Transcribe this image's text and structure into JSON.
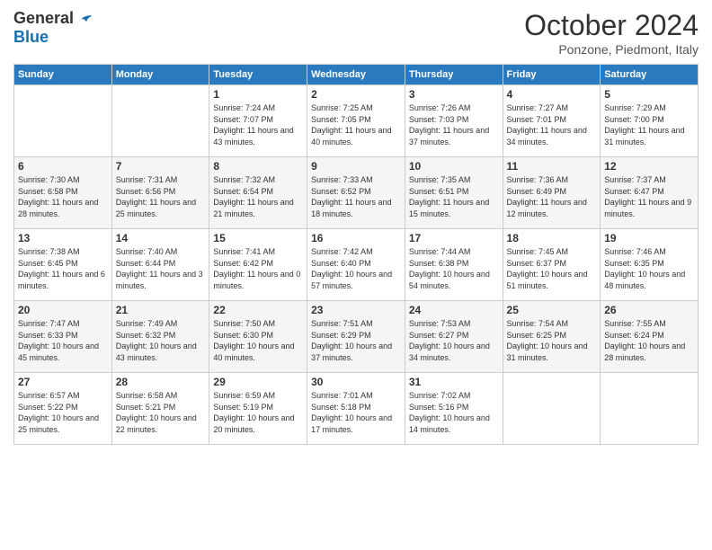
{
  "header": {
    "logo_general": "General",
    "logo_blue": "Blue",
    "month_title": "October 2024",
    "location": "Ponzone, Piedmont, Italy"
  },
  "days_of_week": [
    "Sunday",
    "Monday",
    "Tuesday",
    "Wednesday",
    "Thursday",
    "Friday",
    "Saturday"
  ],
  "weeks": [
    [
      {
        "day": "",
        "info": ""
      },
      {
        "day": "",
        "info": ""
      },
      {
        "day": "1",
        "info": "Sunrise: 7:24 AM\nSunset: 7:07 PM\nDaylight: 11 hours and 43 minutes."
      },
      {
        "day": "2",
        "info": "Sunrise: 7:25 AM\nSunset: 7:05 PM\nDaylight: 11 hours and 40 minutes."
      },
      {
        "day": "3",
        "info": "Sunrise: 7:26 AM\nSunset: 7:03 PM\nDaylight: 11 hours and 37 minutes."
      },
      {
        "day": "4",
        "info": "Sunrise: 7:27 AM\nSunset: 7:01 PM\nDaylight: 11 hours and 34 minutes."
      },
      {
        "day": "5",
        "info": "Sunrise: 7:29 AM\nSunset: 7:00 PM\nDaylight: 11 hours and 31 minutes."
      }
    ],
    [
      {
        "day": "6",
        "info": "Sunrise: 7:30 AM\nSunset: 6:58 PM\nDaylight: 11 hours and 28 minutes."
      },
      {
        "day": "7",
        "info": "Sunrise: 7:31 AM\nSunset: 6:56 PM\nDaylight: 11 hours and 25 minutes."
      },
      {
        "day": "8",
        "info": "Sunrise: 7:32 AM\nSunset: 6:54 PM\nDaylight: 11 hours and 21 minutes."
      },
      {
        "day": "9",
        "info": "Sunrise: 7:33 AM\nSunset: 6:52 PM\nDaylight: 11 hours and 18 minutes."
      },
      {
        "day": "10",
        "info": "Sunrise: 7:35 AM\nSunset: 6:51 PM\nDaylight: 11 hours and 15 minutes."
      },
      {
        "day": "11",
        "info": "Sunrise: 7:36 AM\nSunset: 6:49 PM\nDaylight: 11 hours and 12 minutes."
      },
      {
        "day": "12",
        "info": "Sunrise: 7:37 AM\nSunset: 6:47 PM\nDaylight: 11 hours and 9 minutes."
      }
    ],
    [
      {
        "day": "13",
        "info": "Sunrise: 7:38 AM\nSunset: 6:45 PM\nDaylight: 11 hours and 6 minutes."
      },
      {
        "day": "14",
        "info": "Sunrise: 7:40 AM\nSunset: 6:44 PM\nDaylight: 11 hours and 3 minutes."
      },
      {
        "day": "15",
        "info": "Sunrise: 7:41 AM\nSunset: 6:42 PM\nDaylight: 11 hours and 0 minutes."
      },
      {
        "day": "16",
        "info": "Sunrise: 7:42 AM\nSunset: 6:40 PM\nDaylight: 10 hours and 57 minutes."
      },
      {
        "day": "17",
        "info": "Sunrise: 7:44 AM\nSunset: 6:38 PM\nDaylight: 10 hours and 54 minutes."
      },
      {
        "day": "18",
        "info": "Sunrise: 7:45 AM\nSunset: 6:37 PM\nDaylight: 10 hours and 51 minutes."
      },
      {
        "day": "19",
        "info": "Sunrise: 7:46 AM\nSunset: 6:35 PM\nDaylight: 10 hours and 48 minutes."
      }
    ],
    [
      {
        "day": "20",
        "info": "Sunrise: 7:47 AM\nSunset: 6:33 PM\nDaylight: 10 hours and 45 minutes."
      },
      {
        "day": "21",
        "info": "Sunrise: 7:49 AM\nSunset: 6:32 PM\nDaylight: 10 hours and 43 minutes."
      },
      {
        "day": "22",
        "info": "Sunrise: 7:50 AM\nSunset: 6:30 PM\nDaylight: 10 hours and 40 minutes."
      },
      {
        "day": "23",
        "info": "Sunrise: 7:51 AM\nSunset: 6:29 PM\nDaylight: 10 hours and 37 minutes."
      },
      {
        "day": "24",
        "info": "Sunrise: 7:53 AM\nSunset: 6:27 PM\nDaylight: 10 hours and 34 minutes."
      },
      {
        "day": "25",
        "info": "Sunrise: 7:54 AM\nSunset: 6:25 PM\nDaylight: 10 hours and 31 minutes."
      },
      {
        "day": "26",
        "info": "Sunrise: 7:55 AM\nSunset: 6:24 PM\nDaylight: 10 hours and 28 minutes."
      }
    ],
    [
      {
        "day": "27",
        "info": "Sunrise: 6:57 AM\nSunset: 5:22 PM\nDaylight: 10 hours and 25 minutes."
      },
      {
        "day": "28",
        "info": "Sunrise: 6:58 AM\nSunset: 5:21 PM\nDaylight: 10 hours and 22 minutes."
      },
      {
        "day": "29",
        "info": "Sunrise: 6:59 AM\nSunset: 5:19 PM\nDaylight: 10 hours and 20 minutes."
      },
      {
        "day": "30",
        "info": "Sunrise: 7:01 AM\nSunset: 5:18 PM\nDaylight: 10 hours and 17 minutes."
      },
      {
        "day": "31",
        "info": "Sunrise: 7:02 AM\nSunset: 5:16 PM\nDaylight: 10 hours and 14 minutes."
      },
      {
        "day": "",
        "info": ""
      },
      {
        "day": "",
        "info": ""
      }
    ]
  ]
}
